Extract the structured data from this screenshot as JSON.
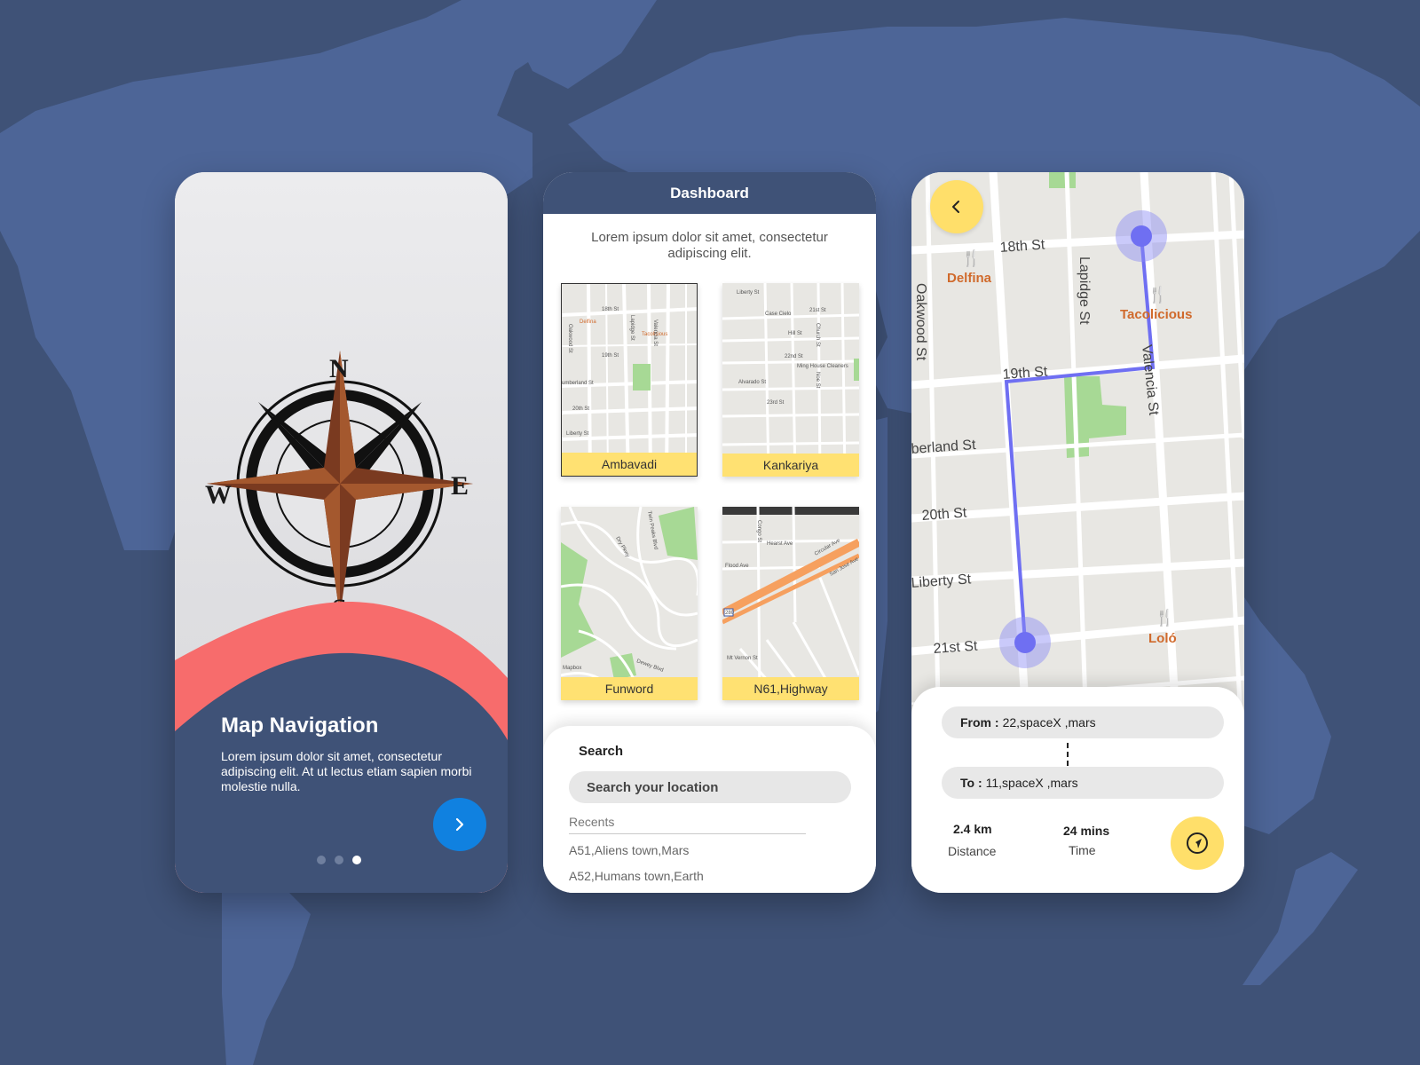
{
  "colors": {
    "background": "#3f5277",
    "continent": "#4d6597",
    "accent_blue": "#1081e0",
    "accent_yellow": "#ffdf6a",
    "card_label_yellow": "#ffe172",
    "coral": "#f76c6c",
    "route": "#6f6ff2"
  },
  "onboarding": {
    "compass": {
      "n": "N",
      "s": "S",
      "e": "E",
      "w": "W"
    },
    "title": "Map Navigation",
    "description": "Lorem ipsum dolor sit amet, consectetur adipiscing elit. At ut lectus etiam sapien morbi molestie nulla.",
    "next_icon": "chevron-right-icon",
    "page_indicator": {
      "total": 3,
      "active": 3
    }
  },
  "dashboard": {
    "title": "Dashboard",
    "intro": "Lorem ipsum dolor sit amet, consectetur adipiscing elit.",
    "maps": [
      {
        "label": "Ambavadi"
      },
      {
        "label": "Kankariya"
      },
      {
        "label": "Funword"
      },
      {
        "label": "N61,Highway"
      }
    ],
    "map_texts": {
      "ambavadi": [
        "18th St",
        "Delfina",
        "Tacolicious",
        "Lapidge St",
        "Valencia St",
        "Oakwood St",
        "19th St",
        "umberland St",
        "20th St",
        "Liberty St"
      ],
      "kankariya": [
        "Liberty St",
        "21st St",
        "Case Cielo",
        "Hill St",
        "Church St",
        "22nd St",
        "Ming House Cleaners",
        "Alvarado St",
        "23rd St",
        "Noe St"
      ],
      "funword": [
        "Dry Pkwy",
        "Mapbox",
        "Dewey Blvd",
        "Twin Peaks Blvd"
      ],
      "highway": [
        "Congo St",
        "Hearst Ave",
        "Circular Ave",
        "Flood Ave",
        "San Jose Ave",
        "280",
        "Mt Vernon St"
      ]
    },
    "search": {
      "label": "Search",
      "placeholder": "Search your location",
      "recents_label": "Recents",
      "recents": [
        "A51,Aliens town,Mars",
        "A52,Humans town,Earth"
      ]
    }
  },
  "navigation": {
    "back_icon": "chevron-left-icon",
    "map_labels": {
      "street_18th": "18th St",
      "delfina": "Delfina",
      "lapidge": "Lapidge St",
      "tacolicious": "Tacolicious",
      "oakwood": "Oakwood St",
      "street_19th": "19th St",
      "valencia": "Valencia St",
      "cumberland": "berland St",
      "street_20th": "20th St",
      "liberty": "Liberty St",
      "street_21st": "21st St",
      "lolo": "Loló"
    },
    "from": {
      "prefix": "From :",
      "value": "22,spaceX ,mars"
    },
    "to": {
      "prefix": "To :",
      "value": "11,spaceX ,mars"
    },
    "distance": {
      "value": "2.4 km",
      "label": "Distance"
    },
    "time": {
      "value": "24 mins",
      "label": "Time"
    },
    "go_icon": "navigation-arrow-icon"
  }
}
